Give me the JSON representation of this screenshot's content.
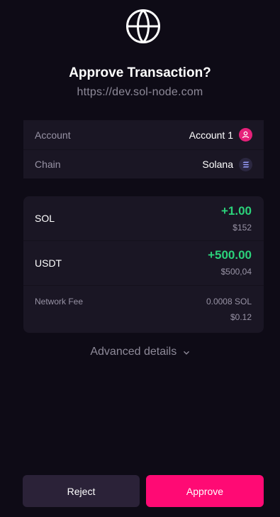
{
  "header": {
    "icon": "globe-icon",
    "title": "Approve Transaction?",
    "origin": "https://dev.sol-node.com"
  },
  "details": {
    "account_label": "Account",
    "account_value": "Account 1",
    "account_icon": "user-icon",
    "chain_label": "Chain",
    "chain_value": "Solana",
    "chain_icon": "solana-icon"
  },
  "transaction": {
    "tokens": [
      {
        "symbol": "SOL",
        "amount": "+1.00",
        "usd": "$152"
      },
      {
        "symbol": "USDT",
        "amount": "+500.00",
        "usd": "$500,04"
      }
    ],
    "fee": {
      "label": "Network Fee",
      "value": "0.0008 SOL",
      "usd": "$0.12"
    }
  },
  "advanced": {
    "label": "Advanced details",
    "icon": "chevron-down-icon"
  },
  "actions": {
    "reject_label": "Reject",
    "approve_label": "Approve"
  },
  "colors": {
    "background": "#0e0b16",
    "card": "#1a1624",
    "positive": "#2bd27a",
    "accent": "#ff0a74",
    "avatar": "#e6217a",
    "reject_button": "#2b2238"
  }
}
